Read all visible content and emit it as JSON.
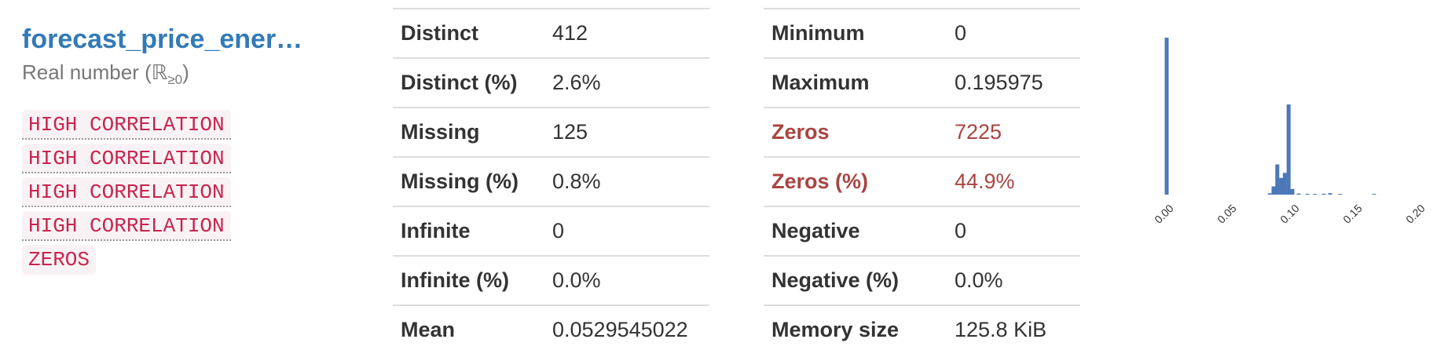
{
  "variable": {
    "name": "forecast_price_ener…",
    "type_prefix": "Real number (ℝ",
    "type_sub": "≥0",
    "type_suffix": ")",
    "badges": [
      {
        "label": "HIGH CORRELATION"
      },
      {
        "label": "HIGH CORRELATION"
      },
      {
        "label": "HIGH CORRELATION"
      },
      {
        "label": "HIGH CORRELATION"
      },
      {
        "label": "ZEROS"
      }
    ]
  },
  "stats_left": [
    {
      "label": "Distinct",
      "value": "412"
    },
    {
      "label": "Distinct (%)",
      "value": "2.6%"
    },
    {
      "label": "Missing",
      "value": "125"
    },
    {
      "label": "Missing (%)",
      "value": "0.8%"
    },
    {
      "label": "Infinite",
      "value": "0"
    },
    {
      "label": "Infinite (%)",
      "value": "0.0%"
    },
    {
      "label": "Mean",
      "value": "0.0529545022"
    }
  ],
  "stats_right": [
    {
      "label": "Minimum",
      "value": "0"
    },
    {
      "label": "Maximum",
      "value": "0.195975"
    },
    {
      "label": "Zeros",
      "value": "7225"
    },
    {
      "label": "Zeros (%)",
      "value": "44.9%"
    },
    {
      "label": "Negative",
      "value": "0"
    },
    {
      "label": "Negative (%)",
      "value": "0.0%"
    },
    {
      "label": "Memory size",
      "value": "125.8 KiB"
    }
  ],
  "colors": {
    "title": "#337ab7",
    "badge_text": "#c7254e",
    "badge_bg": "#f9f2f4",
    "alert": "#a94442",
    "bar": "#4c78b8"
  },
  "chart_data": {
    "type": "bar",
    "xlim": [
      0,
      0.2
    ],
    "x_ticks": [
      "0.00",
      "0.05",
      "0.10",
      "0.15",
      "0.20"
    ],
    "tick_values": [
      0,
      0.05,
      0.1,
      0.15,
      0.2
    ],
    "bins": [
      {
        "x": 0.0,
        "count": 7225
      },
      {
        "x": 0.082,
        "count": 60
      },
      {
        "x": 0.085,
        "count": 380
      },
      {
        "x": 0.088,
        "count": 1390
      },
      {
        "x": 0.091,
        "count": 770
      },
      {
        "x": 0.094,
        "count": 1000
      },
      {
        "x": 0.097,
        "count": 4150
      },
      {
        "x": 0.1,
        "count": 260
      },
      {
        "x": 0.105,
        "count": 50
      },
      {
        "x": 0.112,
        "count": 40
      },
      {
        "x": 0.118,
        "count": 35
      },
      {
        "x": 0.125,
        "count": 45
      },
      {
        "x": 0.13,
        "count": 70
      },
      {
        "x": 0.138,
        "count": 25
      },
      {
        "x": 0.165,
        "count": 15
      }
    ]
  }
}
